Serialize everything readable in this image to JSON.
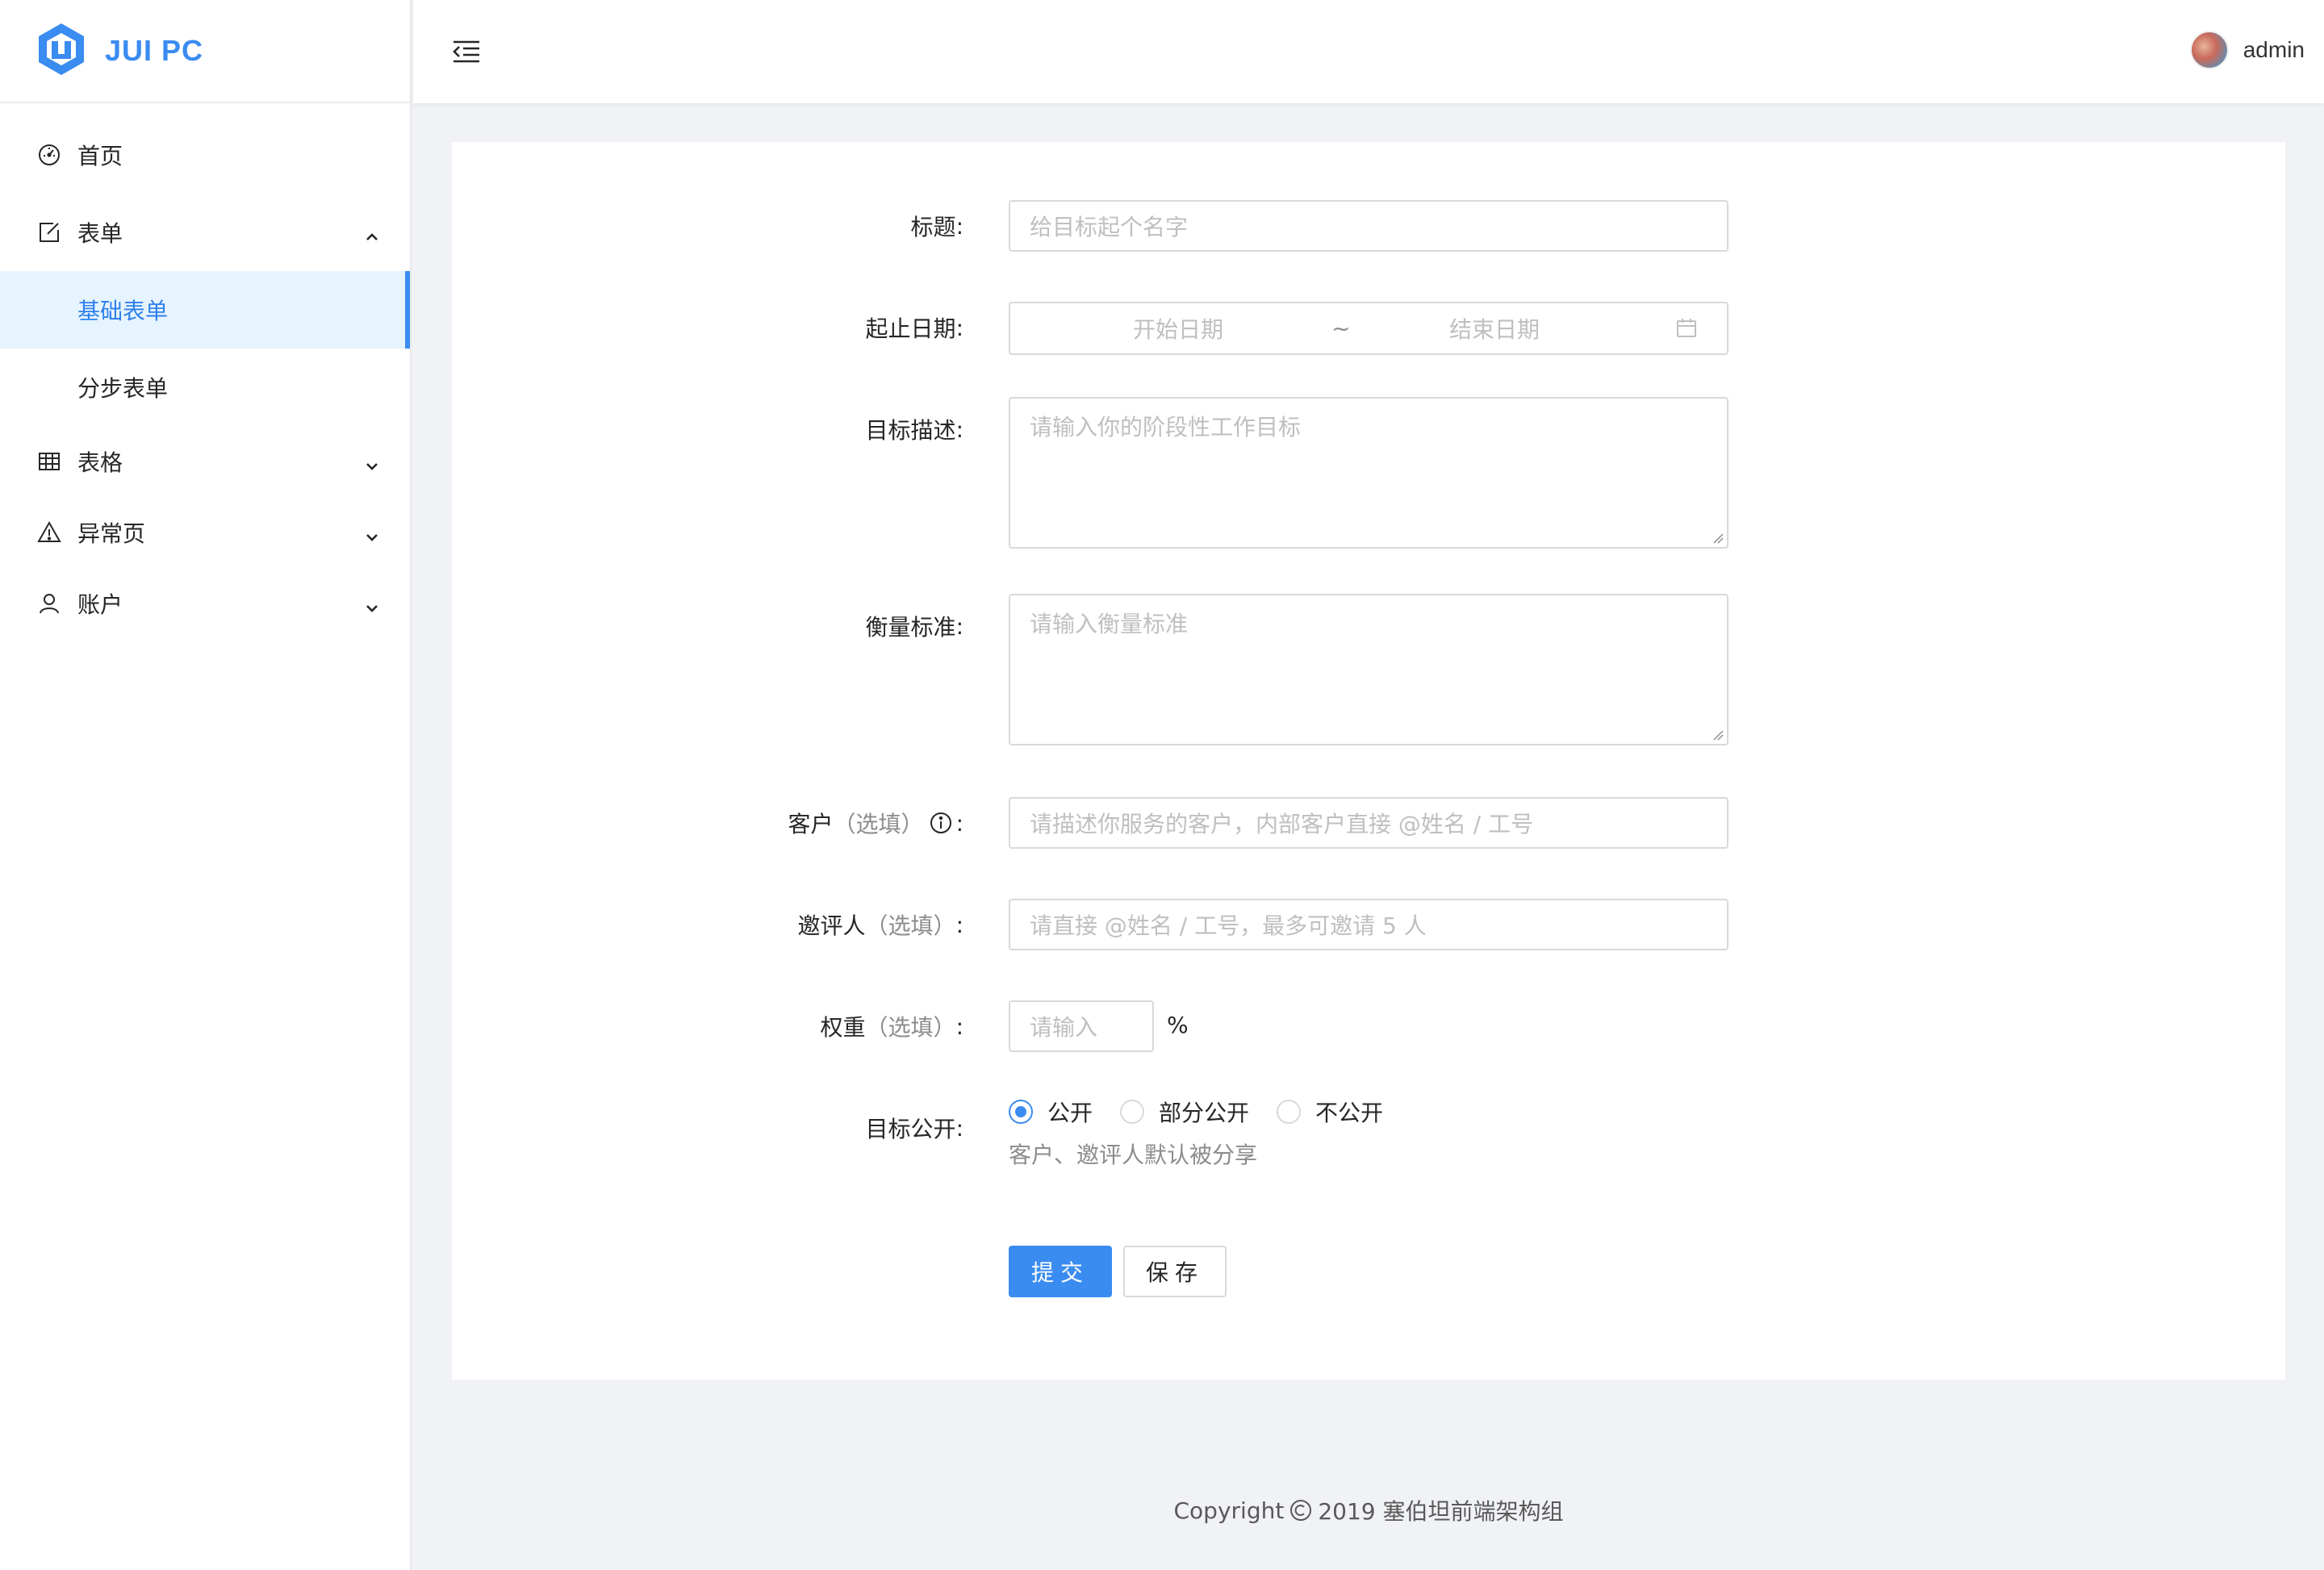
{
  "app": {
    "logo_text": "JUI PC"
  },
  "header": {
    "username": "admin"
  },
  "sidebar": {
    "items": [
      {
        "label": "首页",
        "icon": "dashboard-icon"
      },
      {
        "label": "表单",
        "icon": "edit-icon",
        "expanded": true,
        "children": [
          {
            "label": "基础表单",
            "active": true
          },
          {
            "label": "分步表单",
            "active": false
          }
        ]
      },
      {
        "label": "表格",
        "icon": "table-icon"
      },
      {
        "label": "异常页",
        "icon": "warning-icon"
      },
      {
        "label": "账户",
        "icon": "user-icon"
      }
    ]
  },
  "form": {
    "title": {
      "label": "标题",
      "placeholder": "给目标起个名字"
    },
    "date": {
      "label": "起止日期",
      "start_placeholder": "开始日期",
      "separator": "~",
      "end_placeholder": "结束日期"
    },
    "goal": {
      "label": "目标描述",
      "placeholder": "请输入你的阶段性工作目标"
    },
    "standard": {
      "label": "衡量标准",
      "placeholder": "请输入衡量标准"
    },
    "client": {
      "label": "客户",
      "optional": "（选填）",
      "placeholder": "请描述你服务的客户，内部客户直接 @姓名 / 工号"
    },
    "invitee": {
      "label": "邀评人",
      "optional": "（选填）",
      "placeholder": "请直接 @姓名 / 工号，最多可邀请 5 人"
    },
    "weight": {
      "label": "权重",
      "optional": "（选填）",
      "placeholder": "请输入",
      "suffix": "%"
    },
    "visibility": {
      "label": "目标公开",
      "options": [
        "公开",
        "部分公开",
        "不公开"
      ],
      "selected": "公开",
      "hint": "客户、邀评人默认被分享"
    },
    "submit_label": "提交",
    "save_label": "保存",
    "colon": ":",
    "colon_wide": "："
  },
  "footer": {
    "prefix": "Copyright",
    "suffix": "2019 塞伯坦前端架构组"
  },
  "colors": {
    "primary": "#3b8cf1",
    "active_bg": "#e6f4ff",
    "page_bg": "#f0f2f5"
  }
}
